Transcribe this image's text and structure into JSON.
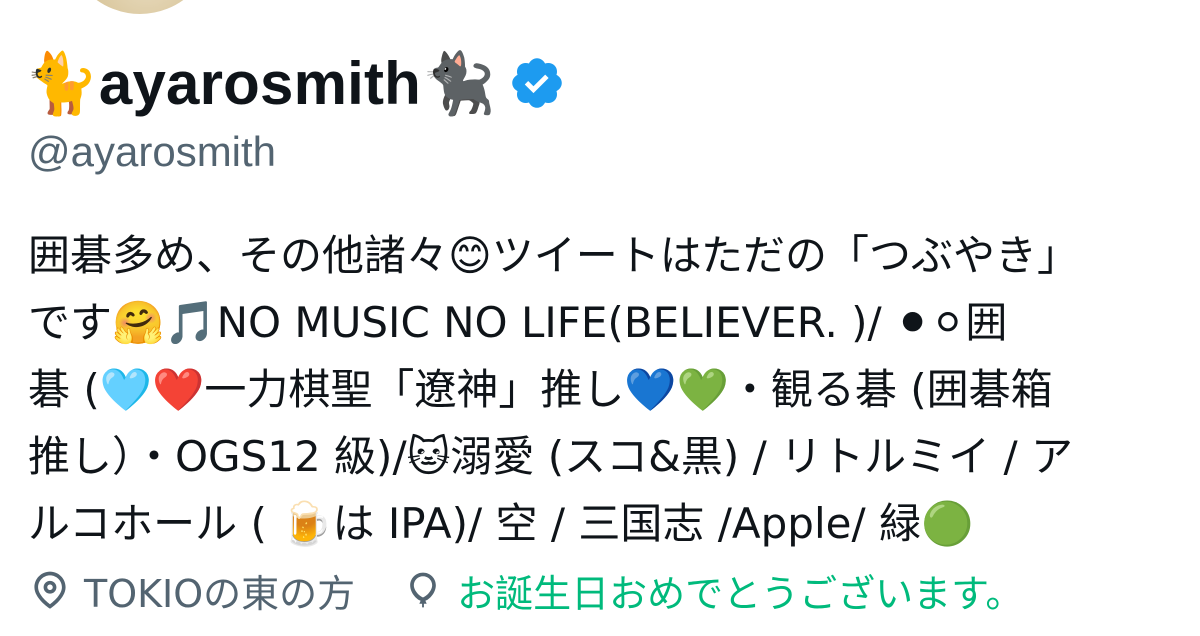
{
  "profile": {
    "display_name": "🐈ayarosmith🐈‍⬛",
    "handle": "@ayarosmith",
    "verified_icon": "verified-badge-icon",
    "bio_lines": [
      "囲碁多め、その他諸々😊ツイートはただの「つぶやき」",
      "です🤗🎵NO MUSIC NO LIFE(BELIEVER. )/ ⚫⚪囲",
      "碁 (🩵❤️一力棋聖「遼神」推し💙💚・観る碁 (囲碁箱",
      "推し）・OGS12 級)/🐱溺愛 (スコ&黒) / リトルミイ / ア",
      "ルコホール ( 🍺は IPA)/ 空 / 三国志 /Apple/ 緑🟢"
    ],
    "location": {
      "icon": "location-pin-icon",
      "text": "TOKIOの東の方"
    },
    "birthday": {
      "icon": "balloon-icon",
      "text": "お誕生日おめでとうございます。"
    }
  },
  "colors": {
    "text_primary": "#0f1419",
    "text_secondary": "#536471",
    "verified_blue": "#1d9bf0",
    "birthday_green": "#00ba7c"
  }
}
